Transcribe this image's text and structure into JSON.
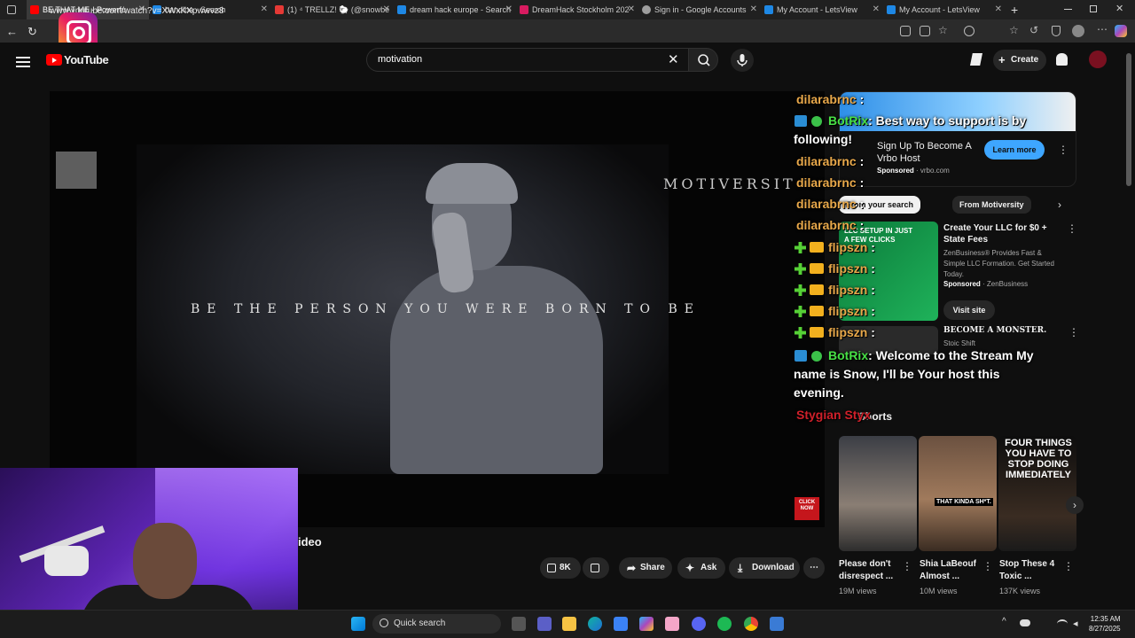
{
  "browser": {
    "tabs": [
      {
        "title": "BE THAT ME - Powerfu",
        "color": "#ff0000"
      },
      {
        "title": "bandlba - Search",
        "color": "#1e88e5"
      },
      {
        "title": "(1) ⁴ TRELLZ! 🐑 (@snowbe",
        "color": "#e53935"
      },
      {
        "title": "dream hack europe - Search",
        "color": "#1e88e5"
      },
      {
        "title": "DreamHack Stockholm 202",
        "color": "#d81b60"
      },
      {
        "title": "Sign in - Google Accounts",
        "color": "#9e9e9e"
      },
      {
        "title": "My Account - LetsView",
        "color": "#1e88e5"
      },
      {
        "title": "My Account - LetsView",
        "color": "#1e88e5"
      }
    ],
    "new_tab": "+",
    "url": "www.youtube.com/watch?v=XWxKXpwwvz8"
  },
  "youtube": {
    "logo_text": "YouTube",
    "search_value": "motivation",
    "create_label": "Create"
  },
  "video": {
    "watermark_text": "MOTIVERSIT",
    "caption": "BE THE PERSON YOU WERE BORN TO BE",
    "click_now": "CLICK NOW",
    "title_fragment": "ideo",
    "actions": {
      "likes": "8K",
      "share": "Share",
      "ask": "Ask",
      "download": "Download"
    }
  },
  "chat": [
    {
      "user": "dilarabrnc",
      "msg": ":",
      "color": "tan"
    },
    {
      "user": "BotRix",
      "msg": ": Best way to support is by",
      "cont": "following!",
      "color": "green"
    },
    {
      "user": "dilarabrnc",
      "msg": ":",
      "color": "tan"
    },
    {
      "user": "dilarabrnc",
      "msg": ":",
      "color": "tan"
    },
    {
      "user": "dilarabrnc",
      "msg": ":",
      "color": "tan"
    },
    {
      "user": "dilarabrnc",
      "msg": ":",
      "color": "tan"
    },
    {
      "user": "flipszn",
      "msg": ":",
      "color": "tan"
    },
    {
      "user": "flipszn",
      "msg": ":",
      "color": "tan"
    },
    {
      "user": "flipszn",
      "msg": ":",
      "color": "tan"
    },
    {
      "user": "flipszn",
      "msg": ":",
      "color": "tan"
    },
    {
      "user": "flipszn",
      "msg": ":",
      "color": "tan"
    },
    {
      "user": "BotRix",
      "msg": ": Welcome to the Stream My",
      "cont1": "name is Snow, I'll be Your host this",
      "cont2": "evening.",
      "color": "green"
    },
    {
      "user": "Stygian Styx",
      "msg": "",
      "color": "red"
    }
  ],
  "sidebar": {
    "ad1": {
      "title": "Sign Up To Become A Vrbo Host",
      "sponsored": "Sponsored",
      "domain": "vrbo.com",
      "cta": "Learn more"
    },
    "chips": [
      "From your search",
      "From Motiversity"
    ],
    "ad2": {
      "title": "Create Your LLC for $0 + State Fees",
      "desc": "ZenBusiness® Provides Fast & Simple LLC Formation. Get Started Today.",
      "sponsored": "Sponsored",
      "advertiser": "ZenBusiness",
      "cta": "Visit site",
      "thumb_text": "LLC SETUP IN JUST A FEW CLICKS"
    },
    "video1": {
      "title": "BECOME A MONSTER.",
      "channel": "Stoic Shift"
    },
    "shorts_label": "Shorts",
    "shorts": [
      {
        "title": "Please don't disrespect ...",
        "views": "19M views"
      },
      {
        "title": "Shia LaBeouf Almost ...",
        "views": "10M views",
        "overlay": "THAT KINDA SH*T."
      },
      {
        "title": "Stop These 4 Toxic ...",
        "views": "137K views",
        "overlay": "FOUR THINGS YOU HAVE TO STOP DOING IMMEDIATELY"
      }
    ]
  },
  "taskbar": {
    "search_label": "Quick search",
    "time": "12:35 AM",
    "date": "8/27/2025"
  }
}
